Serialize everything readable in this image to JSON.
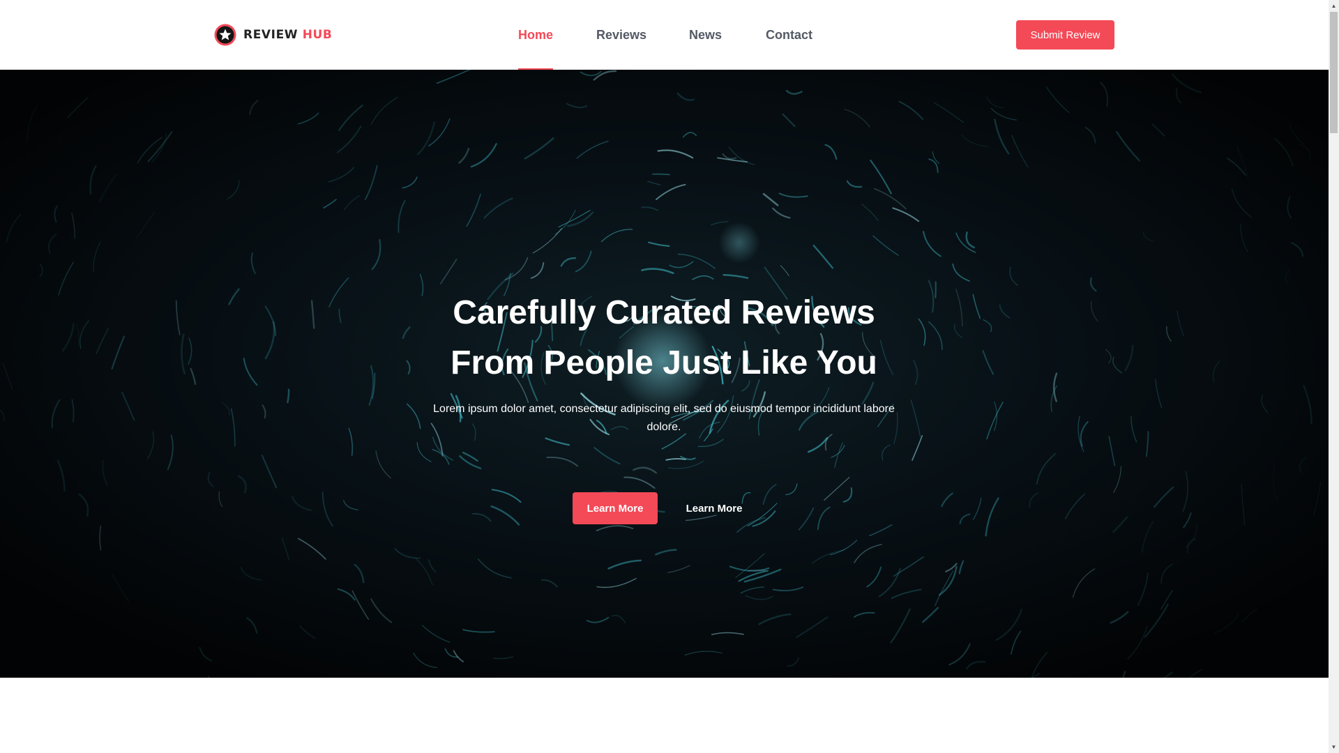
{
  "brand": {
    "name_part1": "REVIEW",
    "name_part2": "HUB",
    "accent_color": "#f44957"
  },
  "nav": {
    "items": [
      {
        "label": "Home",
        "active": true
      },
      {
        "label": "Reviews",
        "active": false
      },
      {
        "label": "News",
        "active": false
      },
      {
        "label": "Contact",
        "active": false
      }
    ]
  },
  "header": {
    "submit_label": "Submit Review"
  },
  "hero": {
    "title_line1": "Carefully Curated Reviews",
    "title_line2": "From People Just Like You",
    "subtitle": "Lorem ipsum dolor amet, consectetur adipiscing elit, sed do eiusmod tempor incididunt labore dolore.",
    "primary_button": "Learn More",
    "secondary_button": "Learn More"
  },
  "scrollbar": {
    "up_icon": "▲",
    "down_icon": "▼"
  }
}
